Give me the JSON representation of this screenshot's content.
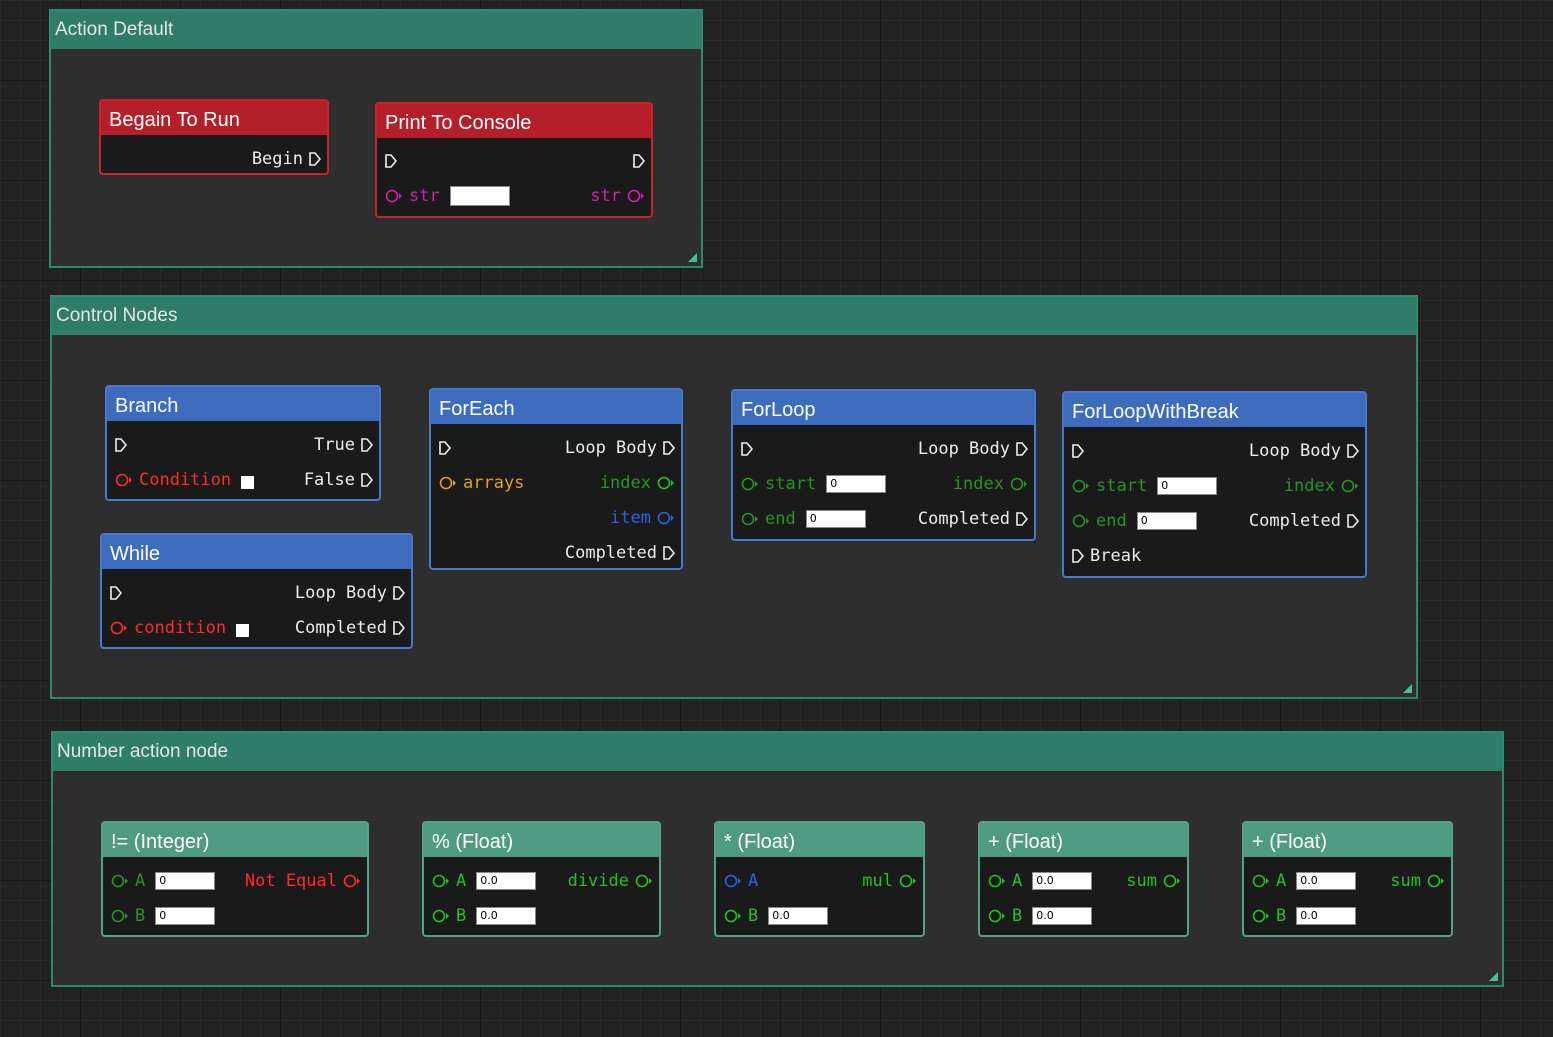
{
  "groups": {
    "action_default": {
      "title": "Action Default"
    },
    "control_nodes": {
      "title": "Control Nodes"
    },
    "number_action": {
      "title": "Number action node"
    }
  },
  "nodes": {
    "begin": {
      "title": "Begain To Run",
      "begin_label": "Begin"
    },
    "print": {
      "title": "Print To Console",
      "str_in": "str",
      "str_out": "str",
      "str_value": ""
    },
    "branch": {
      "title": "Branch",
      "true_label": "True",
      "false_label": "False",
      "condition_label": "Condition"
    },
    "while": {
      "title": "While",
      "loop_body": "Loop Body",
      "completed": "Completed",
      "condition_label": "condition"
    },
    "foreach": {
      "title": "ForEach",
      "loop_body": "Loop Body",
      "arrays": "arrays",
      "index": "index",
      "item": "item",
      "completed": "Completed"
    },
    "forloop": {
      "title": "ForLoop",
      "loop_body": "Loop Body",
      "start": "start",
      "start_value": "0",
      "index": "index",
      "end": "end",
      "end_value": "0",
      "completed": "Completed"
    },
    "forloopbreak": {
      "title": "ForLoopWithBreak",
      "loop_body": "Loop Body",
      "start": "start",
      "start_value": "0",
      "index": "index",
      "end": "end",
      "end_value": "0",
      "completed": "Completed",
      "break": "Break"
    },
    "neq": {
      "title": "!= (Integer)",
      "a": "A",
      "a_value": "0",
      "b": "B",
      "b_value": "0",
      "out": "Not Equal"
    },
    "mod": {
      "title": "% (Float)",
      "a": "A",
      "a_value": "0.0",
      "b": "B",
      "b_value": "0.0",
      "out": "divide"
    },
    "mul": {
      "title": "* (Float)",
      "a": "A",
      "b": "B",
      "b_value": "0.0",
      "out": "mul"
    },
    "add1": {
      "title": "+ (Float)",
      "a": "A",
      "a_value": "0.0",
      "b": "B",
      "b_value": "0.0",
      "out": "sum"
    },
    "add2": {
      "title": "+ (Float)",
      "a": "A",
      "a_value": "0.0",
      "b": "B",
      "b_value": "0.0",
      "out": "sum"
    }
  },
  "colors": {
    "group_header": "#2f7d69",
    "event_node": "#b51f2a",
    "control_node": "#3d6cbf",
    "math_node": "#4f9a82",
    "string_pin": "#d01fb0",
    "bool_pin": "#ff2a2a",
    "array_pin": "#e1a21c",
    "int_pin": "#23c21f",
    "object_pin": "#2a63e6"
  }
}
